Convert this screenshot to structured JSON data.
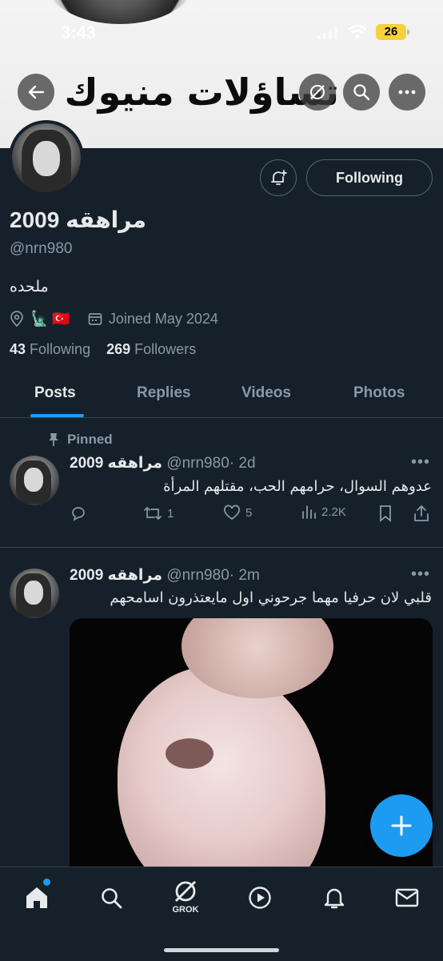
{
  "status_bar": {
    "time": "3:43",
    "battery": "26"
  },
  "banner": {
    "text": "تساؤلات منيوك"
  },
  "profile": {
    "display_name": "مراهقه 2009",
    "handle": "@nrn980",
    "bio": "ملحده",
    "location_emoji": "🗽 🇹🇷",
    "joined": "Joined May 2024",
    "following_count": "43",
    "following_label": "Following",
    "followers_count": "269",
    "followers_label": "Followers",
    "follow_button": "Following"
  },
  "tabs": [
    {
      "label": "Posts",
      "active": true
    },
    {
      "label": "Replies"
    },
    {
      "label": "Videos"
    },
    {
      "label": "Photos"
    }
  ],
  "posts": [
    {
      "pinned_label": "Pinned",
      "name": "مراهقه 2009",
      "handle": "@nrn980",
      "time": "· 2d",
      "text": "عدوهم السوال، حرامهم الحب، مقتلهم المرأة",
      "replies": "",
      "reposts": "1",
      "likes": "5",
      "views": "2.2K"
    },
    {
      "name": "مراهقه 2009",
      "handle": "@nrn980",
      "time": "· 2m",
      "text": "قلبي لان حرفيا مهما جرحوني اول مايعتذرون اسامحهم"
    }
  ],
  "bottom_nav": {
    "grok_label": "GROK"
  },
  "colors": {
    "background": "#15202b",
    "accent": "#1d9bf0",
    "muted": "#8b98a5",
    "text": "#e7e9ea"
  }
}
